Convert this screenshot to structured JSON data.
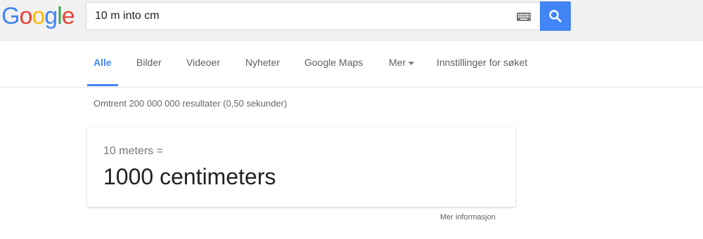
{
  "logo": {
    "letters": [
      "G",
      "o",
      "o",
      "g",
      "l",
      "e"
    ],
    "colors": [
      "#4285f4",
      "#ea4335",
      "#fbbc05",
      "#4285f4",
      "#34a853",
      "#ea4335"
    ]
  },
  "search": {
    "value": "10 m into cm",
    "keyboard_icon": "keyboard-icon",
    "button_icon": "search-icon",
    "button_color": "#4285f4"
  },
  "tabs": [
    {
      "label": "Alle",
      "active": true
    },
    {
      "label": "Bilder",
      "active": false
    },
    {
      "label": "Videoer",
      "active": false
    },
    {
      "label": "Nyheter",
      "active": false
    },
    {
      "label": "Google Maps",
      "active": false
    },
    {
      "label": "Mer",
      "active": false
    },
    {
      "label": "Innstillinger for søket",
      "active": false
    }
  ],
  "results": {
    "stats": "Omtrent 200 000 000 resultater (0,50 sekunder)"
  },
  "conversion": {
    "from": "10 meters =",
    "result": "1000 centimeters",
    "more_info": "Mer informasjon"
  }
}
